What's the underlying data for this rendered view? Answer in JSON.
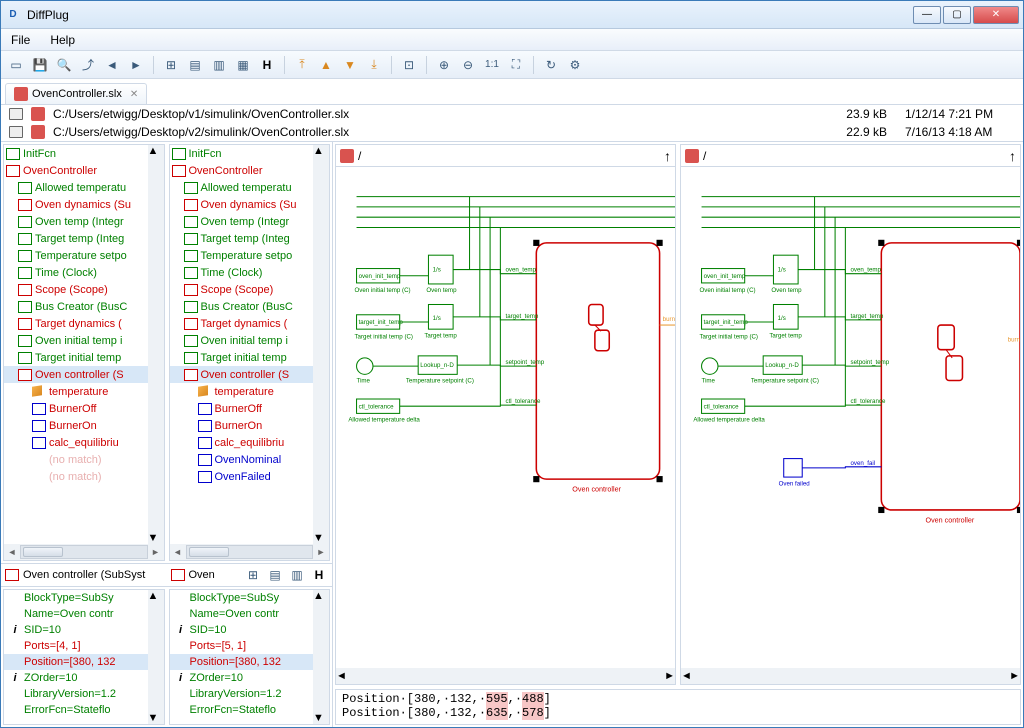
{
  "window": {
    "title": "DiffPlug"
  },
  "menu": {
    "file": "File",
    "help": "Help"
  },
  "tab": {
    "label": "OvenController.slx"
  },
  "files": [
    {
      "path": "C:/Users/etwigg/Desktop/v1/simulink/OvenController.slx",
      "size": "23.9 kB",
      "date": "1/12/14 7:21 PM"
    },
    {
      "path": "C:/Users/etwigg/Desktop/v2/simulink/OvenController.slx",
      "size": "22.9 kB",
      "date": "7/16/13 4:18 AM"
    }
  ],
  "tree_left": [
    {
      "t": "InitFcn",
      "c": "green",
      "ind": 0,
      "icon": "ibox-green"
    },
    {
      "t": "OvenController",
      "c": "red",
      "ind": 0,
      "icon": "ibox-red"
    },
    {
      "t": "Allowed temperatu",
      "c": "green",
      "ind": 1,
      "icon": "ibox-green"
    },
    {
      "t": "Oven dynamics (Su",
      "c": "red",
      "ind": 1,
      "icon": "ibox-red"
    },
    {
      "t": "Oven temp (Integr",
      "c": "green",
      "ind": 1,
      "icon": "ibox-green"
    },
    {
      "t": "Target temp (Integ",
      "c": "green",
      "ind": 1,
      "icon": "ibox-green"
    },
    {
      "t": "Temperature setpo",
      "c": "green",
      "ind": 1,
      "icon": "ibox-green"
    },
    {
      "t": "Time (Clock)",
      "c": "green",
      "ind": 1,
      "icon": "ibox-green"
    },
    {
      "t": "Scope (Scope)",
      "c": "red",
      "ind": 1,
      "icon": "ibox-red"
    },
    {
      "t": "Bus Creator (BusC",
      "c": "green",
      "ind": 1,
      "icon": "ibox-green"
    },
    {
      "t": "Target dynamics (",
      "c": "red",
      "ind": 1,
      "icon": "ibox-red"
    },
    {
      "t": "Oven initial temp i",
      "c": "green",
      "ind": 1,
      "icon": "ibox-green"
    },
    {
      "t": "Target initial temp",
      "c": "green",
      "ind": 1,
      "icon": "ibox-green"
    },
    {
      "t": "Oven controller (S",
      "c": "red",
      "ind": 1,
      "icon": "ibox-red",
      "sel": true
    },
    {
      "t": "temperature",
      "c": "red",
      "ind": 2,
      "icon": "ibox-cube"
    },
    {
      "t": "BurnerOff",
      "c": "red",
      "ind": 2,
      "icon": "ibox-blue"
    },
    {
      "t": "BurnerOn",
      "c": "red",
      "ind": 2,
      "icon": "ibox-blue"
    },
    {
      "t": "calc_equilibriu",
      "c": "red",
      "ind": 2,
      "icon": "ibox-blue"
    },
    {
      "t": "(no match)",
      "c": "pink",
      "ind": 2,
      "icon": ""
    },
    {
      "t": "(no match)",
      "c": "pink",
      "ind": 2,
      "icon": ""
    }
  ],
  "tree_right": [
    {
      "t": "InitFcn",
      "c": "green",
      "ind": 0,
      "icon": "ibox-green"
    },
    {
      "t": "OvenController",
      "c": "red",
      "ind": 0,
      "icon": "ibox-red"
    },
    {
      "t": "Allowed temperatu",
      "c": "green",
      "ind": 1,
      "icon": "ibox-green"
    },
    {
      "t": "Oven dynamics (Su",
      "c": "red",
      "ind": 1,
      "icon": "ibox-red"
    },
    {
      "t": "Oven temp (Integr",
      "c": "green",
      "ind": 1,
      "icon": "ibox-green"
    },
    {
      "t": "Target temp (Integ",
      "c": "green",
      "ind": 1,
      "icon": "ibox-green"
    },
    {
      "t": "Temperature setpo",
      "c": "green",
      "ind": 1,
      "icon": "ibox-green"
    },
    {
      "t": "Time (Clock)",
      "c": "green",
      "ind": 1,
      "icon": "ibox-green"
    },
    {
      "t": "Scope (Scope)",
      "c": "red",
      "ind": 1,
      "icon": "ibox-red"
    },
    {
      "t": "Bus Creator (BusC",
      "c": "green",
      "ind": 1,
      "icon": "ibox-green"
    },
    {
      "t": "Target dynamics (",
      "c": "red",
      "ind": 1,
      "icon": "ibox-red"
    },
    {
      "t": "Oven initial temp i",
      "c": "green",
      "ind": 1,
      "icon": "ibox-green"
    },
    {
      "t": "Target initial temp",
      "c": "green",
      "ind": 1,
      "icon": "ibox-green"
    },
    {
      "t": "Oven controller (S",
      "c": "red",
      "ind": 1,
      "icon": "ibox-red",
      "sel": true
    },
    {
      "t": "temperature",
      "c": "red",
      "ind": 2,
      "icon": "ibox-cube"
    },
    {
      "t": "BurnerOff",
      "c": "red",
      "ind": 2,
      "icon": "ibox-blue"
    },
    {
      "t": "BurnerOn",
      "c": "red",
      "ind": 2,
      "icon": "ibox-blue"
    },
    {
      "t": "calc_equilibriu",
      "c": "red",
      "ind": 2,
      "icon": "ibox-blue"
    },
    {
      "t": "OvenNominal",
      "c": "blue",
      "ind": 2,
      "icon": "ibox-blue"
    },
    {
      "t": "OvenFailed",
      "c": "blue",
      "ind": 2,
      "icon": "ibox-blue"
    }
  ],
  "midbar": {
    "left": "Oven controller (SubSyst",
    "right": "Oven"
  },
  "props_left": [
    {
      "t": "BlockType=SubSy",
      "c": "green",
      "i": ""
    },
    {
      "t": "Name=Oven contr",
      "c": "green",
      "i": ""
    },
    {
      "t": "SID=10",
      "c": "green",
      "i": "i"
    },
    {
      "t": "Ports=[4, 1]",
      "c": "red",
      "i": ""
    },
    {
      "t": "Position=[380, 132",
      "c": "red",
      "i": "",
      "sel": true
    },
    {
      "t": "ZOrder=10",
      "c": "green",
      "i": "i"
    },
    {
      "t": "LibraryVersion=1.2",
      "c": "green",
      "i": ""
    },
    {
      "t": "ErrorFcn=Stateflo",
      "c": "green",
      "i": ""
    }
  ],
  "props_right": [
    {
      "t": "BlockType=SubSy",
      "c": "green",
      "i": ""
    },
    {
      "t": "Name=Oven contr",
      "c": "green",
      "i": ""
    },
    {
      "t": "SID=10",
      "c": "green",
      "i": "i"
    },
    {
      "t": "Ports=[5, 1]",
      "c": "red",
      "i": ""
    },
    {
      "t": "Position=[380, 132",
      "c": "red",
      "i": "",
      "sel": true
    },
    {
      "t": "ZOrder=10",
      "c": "green",
      "i": "i"
    },
    {
      "t": "LibraryVersion=1.2",
      "c": "green",
      "i": ""
    },
    {
      "t": "ErrorFcn=Stateflo",
      "c": "green",
      "i": ""
    }
  ],
  "diag": {
    "path": "/",
    "uparrow": "↑"
  },
  "diff_text": {
    "prefix1": "Position·[380,·132,·",
    "a1": "595",
    "m1": ",·",
    "a2": "488",
    "suf1": "]",
    "prefix2": "Position·[380,·132,·",
    "b1": "635",
    "m2": ",·",
    "b2": "578",
    "suf2": "]"
  },
  "diagram": {
    "labels": {
      "oven_init": "Oven initial temp (C)",
      "target_init": "Target initial temp (C)",
      "time": "Time",
      "temp_setpoint": "Temperature setpoint (C)",
      "allowed": "Allowed temperature delta",
      "oven_temp": "Oven temp",
      "target_temp": "Target temp",
      "lookup": "Lookup_n-D",
      "ctl_tol": "ctl_tolerance",
      "oven_ctrl": "Oven controller",
      "oven_failed": "Oven failed",
      "in_oven": "oven_init_temp",
      "in_target": "target_init_temp",
      "oven_temp_sig": "oven_temp",
      "target_temp_sig": "target_temp",
      "setpoint_sig": "setpoint_temp",
      "tol_sig": "ctl_tolerance",
      "fail_sig": "oven_fail",
      "burner_sig": "burner_on"
    }
  }
}
